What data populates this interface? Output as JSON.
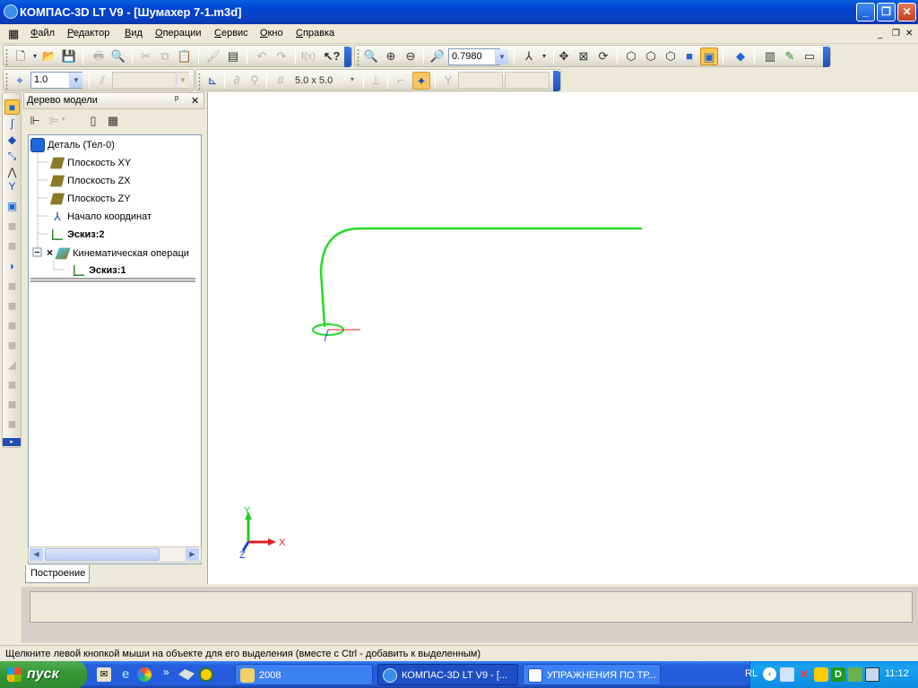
{
  "window": {
    "title": "КОМПАС-3D LT V9 - [Шумахер 7-1.m3d]",
    "controls": {
      "minimize": "_",
      "maximize": "❐",
      "close": "✕"
    }
  },
  "menu": {
    "items": [
      "Файл",
      "Редактор",
      "Вид",
      "Операции",
      "Сервис",
      "Окно",
      "Справка"
    ],
    "doc_controls": {
      "minimize": "_",
      "restore": "❐",
      "close": "✕"
    }
  },
  "toolbar1": {
    "zoom_value": "0.7980"
  },
  "toolbar2": {
    "scale_value": "1.0",
    "style_value": "",
    "grid_value": "5.0 x 5.0"
  },
  "tree": {
    "title": "Дерево модели",
    "pin": "ᵖ",
    "close": "✕",
    "tab": "Построение",
    "nodes": [
      {
        "label": "Деталь (Тел-0)",
        "bold": false,
        "icon": "part-icon"
      },
      {
        "label": "Плоскость XY",
        "bold": false,
        "icon": "plane-icon"
      },
      {
        "label": "Плоскость ZX",
        "bold": false,
        "icon": "plane-icon"
      },
      {
        "label": "Плоскость ZY",
        "bold": false,
        "icon": "plane-icon"
      },
      {
        "label": "Начало координат",
        "bold": false,
        "icon": "origin-icon"
      },
      {
        "label": "Эскиз:2",
        "bold": true,
        "icon": "sketch-icon"
      },
      {
        "label": "Кинематическая операци",
        "bold": false,
        "icon": "sweep-icon"
      },
      {
        "label": "Эскиз:1",
        "bold": true,
        "icon": "sketch-icon"
      }
    ]
  },
  "canvas": {
    "axis_labels": {
      "x": "X",
      "y": "Y",
      "z": "Z"
    },
    "path_color": "#22dd22",
    "axis_x_color": "#e02020",
    "axis_y_color": "#22cc22",
    "axis_z_color": "#2040e0"
  },
  "status": {
    "message": "Щелкните левой кнопкой мыши на объекте для его выделения (вместе с Ctrl - добавить к выделенным)"
  },
  "taskbar": {
    "start": "пуск",
    "chevron": "»",
    "tasks": [
      {
        "label": "2008",
        "active": false
      },
      {
        "label": "КОМПАС-3D LT V9 - [...",
        "active": true
      },
      {
        "label": "УПРАЖНЕНИЯ ПО ТР...",
        "active": false
      }
    ],
    "lang": "RL",
    "clock": "11:12"
  }
}
